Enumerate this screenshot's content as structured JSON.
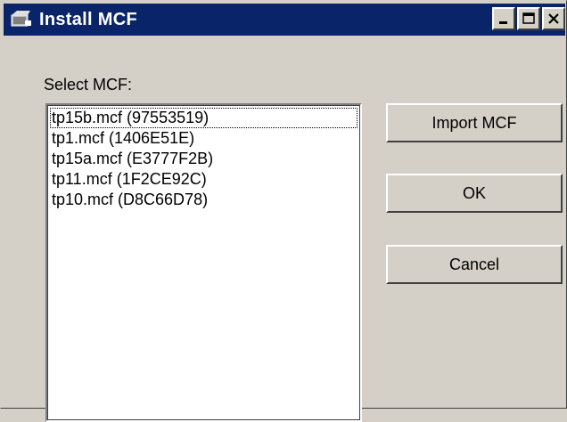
{
  "window": {
    "title": "Install MCF",
    "controls": [
      "minimize-icon",
      "maximize-icon",
      "close-icon"
    ]
  },
  "dialog": {
    "select_label": "Select MCF:",
    "mcf_list": [
      "tp15b.mcf (97553519)",
      "tp1.mcf (1406E51E)",
      "tp15a.mcf (E3777F2B)",
      "tp11.mcf (1F2CE92C)",
      "tp10.mcf (D8C66D78)"
    ],
    "focused_index": 0,
    "buttons": {
      "import": "Import MCF",
      "ok": "OK",
      "cancel": "Cancel"
    }
  },
  "colors": {
    "titlebar": "#0a246a",
    "face": "#d4d0c8",
    "list_bg": "#ffffff"
  }
}
